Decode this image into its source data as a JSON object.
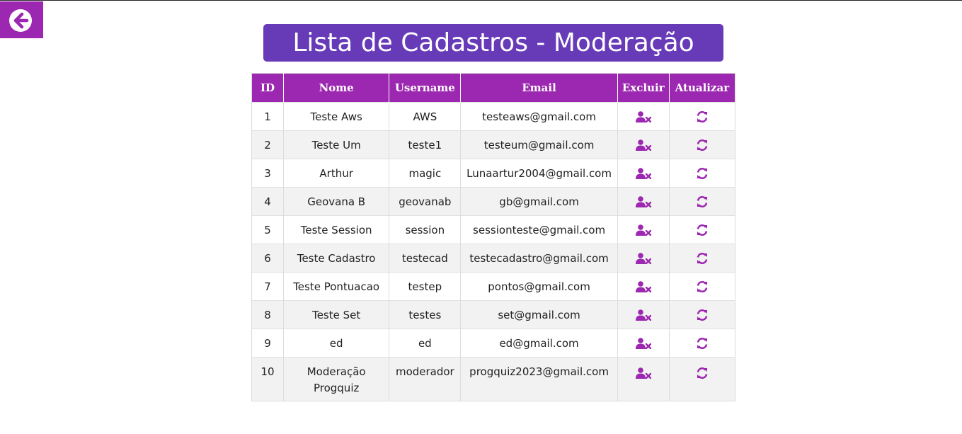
{
  "page": {
    "title": "Lista de Cadastros - Moderação"
  },
  "colors": {
    "accent_purple": "#9c27b0",
    "title_purple": "#673ab7"
  },
  "icons": {
    "back": "arrow-left-circle-icon",
    "delete": "user-remove-icon",
    "update": "refresh-icon"
  },
  "table": {
    "headers": [
      "ID",
      "Nome",
      "Username",
      "Email",
      "Excluir",
      "Atualizar"
    ],
    "rows": [
      {
        "id": "1",
        "nome": "Teste Aws",
        "username": "AWS",
        "email": "testeaws@gmail.com"
      },
      {
        "id": "2",
        "nome": "Teste Um",
        "username": "teste1",
        "email": "testeum@gmail.com"
      },
      {
        "id": "3",
        "nome": "Arthur",
        "username": "magic",
        "email": "Lunaartur2004@gmail.com"
      },
      {
        "id": "4",
        "nome": "Geovana B",
        "username": "geovanab",
        "email": "gb@gmail.com"
      },
      {
        "id": "5",
        "nome": "Teste Session",
        "username": "session",
        "email": "sessionteste@gmail.com"
      },
      {
        "id": "6",
        "nome": "Teste Cadastro",
        "username": "testecad",
        "email": "testecadastro@gmail.com"
      },
      {
        "id": "7",
        "nome": "Teste Pontuacao",
        "username": "testep",
        "email": "pontos@gmail.com"
      },
      {
        "id": "8",
        "nome": "Teste Set",
        "username": "testes",
        "email": "set@gmail.com"
      },
      {
        "id": "9",
        "nome": "ed",
        "username": "ed",
        "email": "ed@gmail.com"
      },
      {
        "id": "10",
        "nome": "Moderação Progquiz",
        "username": "moderador",
        "email": "progquiz2023@gmail.com"
      }
    ]
  }
}
